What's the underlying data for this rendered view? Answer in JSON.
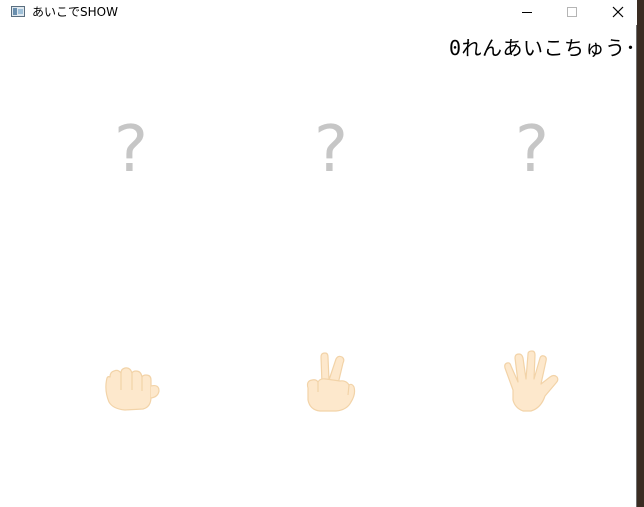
{
  "window": {
    "title": "あいこでSHOW",
    "controls": {
      "minimize": "minimize-icon",
      "maximize": "maximize-icon",
      "close": "close-icon"
    }
  },
  "status": {
    "streak_text": "0れんあいこちゅう･"
  },
  "slots": [
    {
      "text": "?"
    },
    {
      "text": "?"
    },
    {
      "text": "?"
    }
  ],
  "hands": [
    {
      "name": "rock",
      "icon": "rock-hand-icon"
    },
    {
      "name": "scissors",
      "icon": "scissors-hand-icon"
    },
    {
      "name": "paper",
      "icon": "paper-hand-icon"
    }
  ],
  "colors": {
    "window_bg": "#ffffff",
    "question_mark": "#c6c6c6",
    "hand_fill": "#fde8cc",
    "hand_stroke": "#f2d3a8"
  }
}
